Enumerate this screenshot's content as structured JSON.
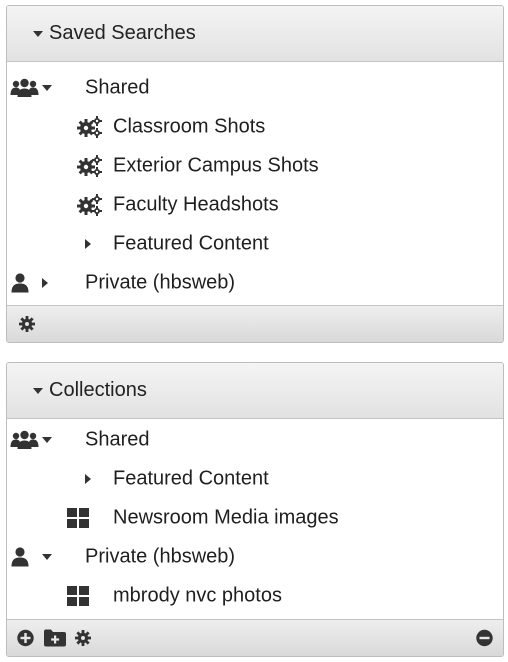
{
  "saved_searches": {
    "title": "Saved Searches",
    "shared_label": "Shared",
    "items": [
      {
        "label": "Classroom Shots",
        "icon": "gears-icon"
      },
      {
        "label": "Exterior Campus Shots",
        "icon": "gears-icon"
      },
      {
        "label": "Faculty Headshots",
        "icon": "gears-icon"
      }
    ],
    "featured_label": "Featured Content",
    "private_label": "Private (hbsweb)"
  },
  "collections": {
    "title": "Collections",
    "shared_label": "Shared",
    "featured_label": "Featured Content",
    "newsroom_label": "Newsroom Media images",
    "private_label": "Private (hbsweb)",
    "private_item_label": "mbrody nvc photos"
  },
  "icons": {
    "shared": "users-icon",
    "private": "user-icon",
    "search": "gears-icon",
    "collection": "grid-icon",
    "settings": "gear-icon",
    "add": "plus-circle-icon",
    "new_folder": "folder-plus-icon",
    "remove": "minus-circle-icon"
  }
}
